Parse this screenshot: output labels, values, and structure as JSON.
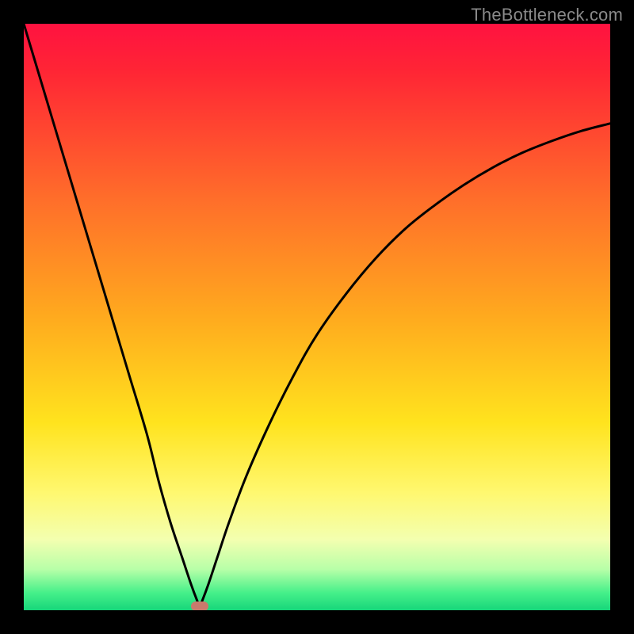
{
  "watermark": "TheBottleneck.com",
  "chart_data": {
    "type": "line",
    "title": "",
    "xlabel": "",
    "ylabel": "",
    "xlim": [
      0,
      100
    ],
    "ylim": [
      0,
      100
    ],
    "grid": false,
    "legend": false,
    "gradient_stops": [
      {
        "offset": 0.0,
        "color": "#ff1240"
      },
      {
        "offset": 0.08,
        "color": "#ff2535"
      },
      {
        "offset": 0.3,
        "color": "#ff6e2a"
      },
      {
        "offset": 0.5,
        "color": "#ffaa1e"
      },
      {
        "offset": 0.68,
        "color": "#ffe31e"
      },
      {
        "offset": 0.8,
        "color": "#fff870"
      },
      {
        "offset": 0.88,
        "color": "#f3ffb0"
      },
      {
        "offset": 0.93,
        "color": "#b8ffa8"
      },
      {
        "offset": 0.97,
        "color": "#46f08a"
      },
      {
        "offset": 1.0,
        "color": "#17d67a"
      }
    ],
    "series": [
      {
        "name": "bottleneck-curve",
        "color": "#000000",
        "x": [
          0,
          3,
          6,
          9,
          12,
          15,
          18,
          21,
          23,
          25,
          27,
          28.5,
          29.5,
          30,
          30.5,
          31.5,
          33,
          35,
          38,
          42,
          46,
          50,
          55,
          60,
          65,
          70,
          75,
          80,
          85,
          90,
          95,
          100
        ],
        "y": [
          100,
          90,
          80,
          70,
          60,
          50,
          40,
          30,
          22,
          15,
          9,
          4.5,
          1.8,
          0.7,
          1.8,
          4.5,
          9,
          15,
          23,
          32,
          40,
          47,
          54,
          60,
          65,
          69,
          72.5,
          75.5,
          78,
          80,
          81.7,
          83
        ]
      }
    ],
    "markers": [
      {
        "name": "optimal-point",
        "x": 30,
        "y": 0.7,
        "color": "#c97a6c"
      }
    ]
  }
}
